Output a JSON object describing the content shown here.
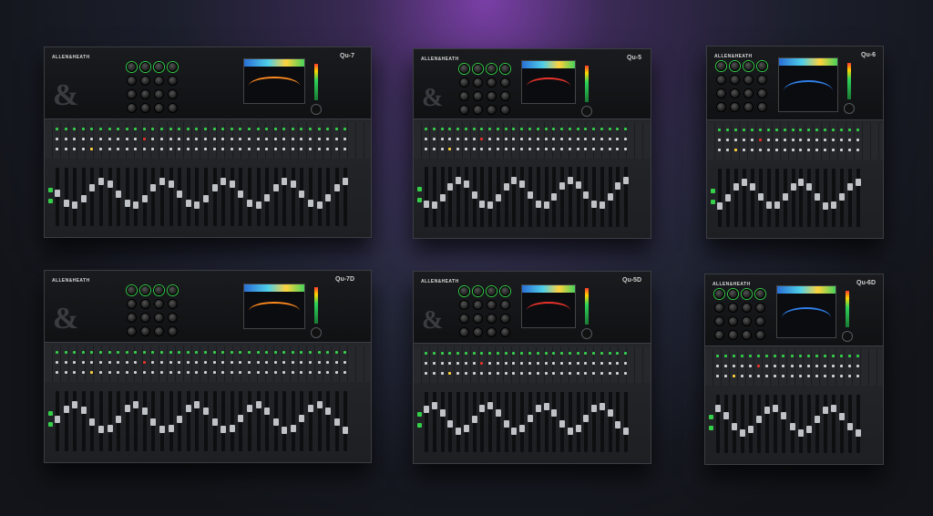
{
  "brand": "ALLEN&HEATH",
  "consoles": [
    {
      "id": "large-1",
      "model": "Qu-7",
      "channels": 34
    },
    {
      "id": "medium-1",
      "model": "Qu-5",
      "channels": 26
    },
    {
      "id": "small-1",
      "model": "Qu-6",
      "channels": 18
    },
    {
      "id": "large-2",
      "model": "Qu-7D",
      "channels": 34
    },
    {
      "id": "medium-2",
      "model": "Qu-5D",
      "channels": 26
    },
    {
      "id": "small-2",
      "model": "Qu-6D",
      "channels": 18
    }
  ],
  "colors": {
    "accent_green": "#35d04a",
    "accent_blue": "#2f7fe8",
    "accent_yellow": "#ffd23c",
    "accent_red": "#e8332a",
    "background_purple": "#7a3fa6"
  }
}
